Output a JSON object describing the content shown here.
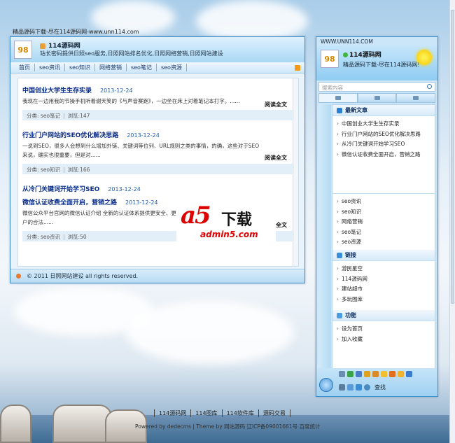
{
  "site_caption": "精品源码下载-尽在114源码网-www.unn114.com",
  "main": {
    "title": "114源码网",
    "slogan": "站长密码提供日照seo服务,日照网站排名优化,日照网络营销,日照网站建设",
    "nav": [
      "首页",
      "seo资讯",
      "seo知识",
      "网络营销",
      "seo笔记",
      "seo资源"
    ],
    "articles": [
      {
        "title": "中国创业大学生生存实录",
        "date": "2013-12-24",
        "excerpt": "我现在一边用我的节操手机听着谢天笑的《与声音赛跑》，一边坐在床上对着笔记本打字。......",
        "read_more": "阅读全文",
        "category": "分类: seo笔记",
        "views": "浏览:147"
      },
      {
        "title": "行业门户网站的SEO优化解决思路",
        "date": "2013-12-24",
        "excerpt": "一说到SEO，很多人会想到什么增加外链、关键词等位列、URL规则之类的事情，的确，这些对于SEO来说，确实也很重要，但是对......",
        "read_more": "阅读全文",
        "category": "分类: seo知识",
        "views": "浏览:166"
      },
      {
        "title": "从冷门关键词开始学习SEO",
        "date": "2013-12-24"
      },
      {
        "title": "微信认证收费全面开启，营销之路",
        "date": "2013-12-24",
        "excerpt": "微信公众平台官网的微信认证介绍 全新的认证体系提供更安全、更",
        "excerpt_tail": "及用户的合法......",
        "read_more": "全文",
        "category": "分类: seo资讯",
        "views": "浏览:50"
      }
    ],
    "footer": "© 2011 日照网站建设 all rights reserved."
  },
  "banner": {
    "big": "a5",
    "cn": "下载",
    "url": "admin5.com"
  },
  "side": {
    "titlebar": "WWW.UNN114.COM",
    "name": "114源码网",
    "signature": "精品源码下载-尽在114源码网!",
    "search_placeholder": "搜索内容",
    "latest_title": "最新文章",
    "latest": [
      "中国创业大学生生存实录",
      "行业门户网站的SEO优化解决思路",
      "从冷门关键词开始学习SEO",
      "微信认证收费全面开启，营销之路"
    ],
    "categories": [
      "seo资讯",
      "seo知识",
      "网络营销",
      "seo笔记",
      "seo资源"
    ],
    "links_title": "链接",
    "links": [
      "游民星空",
      "114源码网",
      "建站超市",
      "多玩图库"
    ],
    "func_title": "功能",
    "funcs": [
      "设为首页",
      "加入收藏"
    ],
    "find_label": "查找"
  },
  "page_footer": {
    "links": [
      "114源码网",
      "114图库",
      "114软件库",
      "源码交易"
    ],
    "powered": "Powered by dedecms | Theme by 网站源码 辽ICP备09001661号 百度统计"
  },
  "colors": {
    "accent": "#3d8fcb",
    "title_blue": "#0b2e8a",
    "banner_red": "#dd0000"
  }
}
